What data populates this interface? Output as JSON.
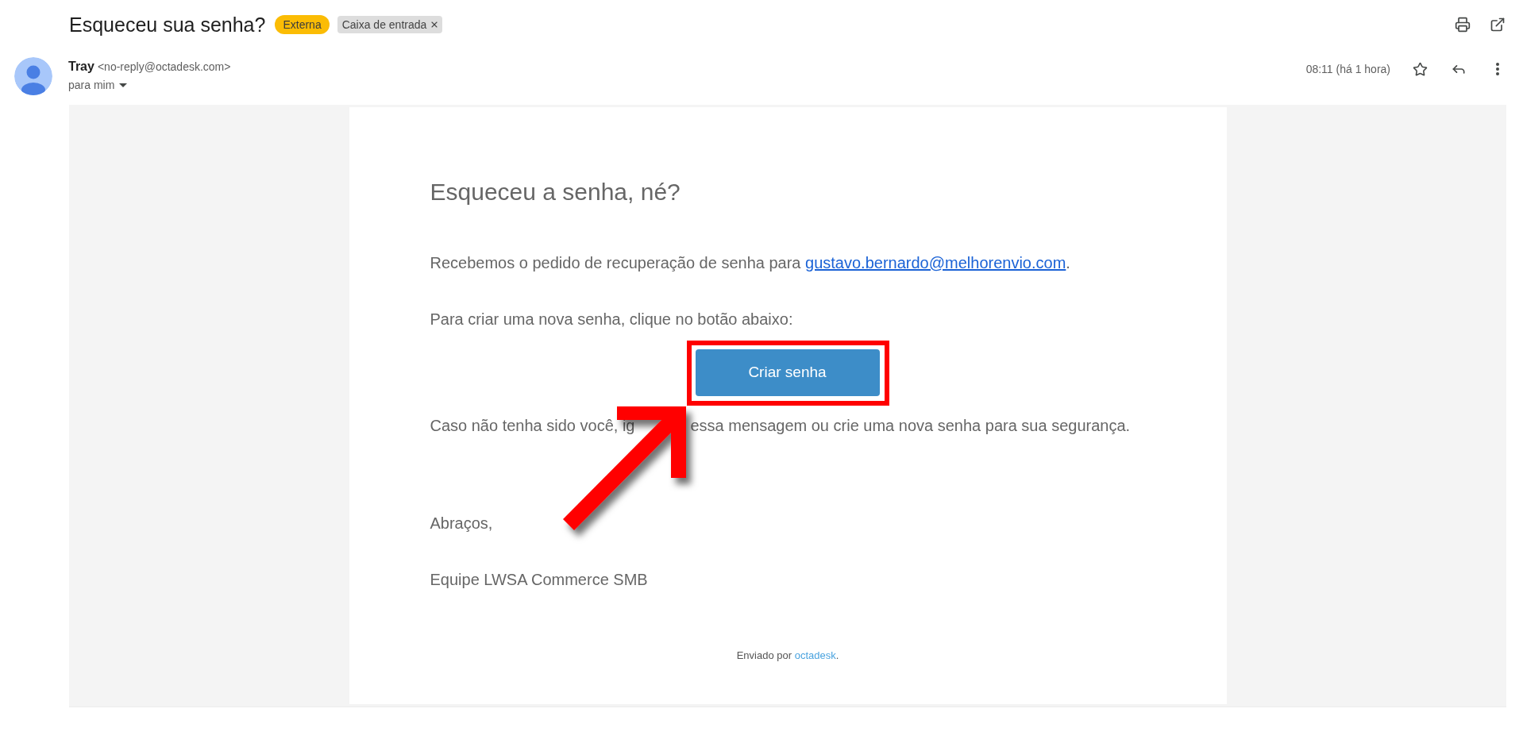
{
  "email": {
    "subject": "Esqueceu sua senha?",
    "labels": [
      {
        "kind": "external",
        "text": "Externa"
      },
      {
        "kind": "folder",
        "text": "Caixa de entrada",
        "removable": true
      }
    ]
  },
  "sender": {
    "name": "Tray",
    "address": "<no-reply@octadesk.com>",
    "recipient": "para mim",
    "time": "08:11 (há 1 hora)",
    "starred": false
  },
  "message": {
    "heading": "Esqueceu a senha, né?",
    "blocks": [
      {
        "kind": "text_link",
        "before": "Recebemos o pedido de recuperação de senha para",
        "link": "gustavo.bernardo@melhorenvio.com",
        "after": "."
      },
      {
        "kind": "text",
        "text": "Para criar uma nova senha, clique no botão abaixo:"
      },
      {
        "kind": "button",
        "label": "Criar senha",
        "highlighted": true
      },
      {
        "kind": "covered_text",
        "parts": [
          "Caso não tenha sido você, ig",
          "essa mensagem ou crie uma nova senha para sua segurança."
        ]
      },
      {
        "kind": "text",
        "text": "Abraços,"
      },
      {
        "kind": "text",
        "text": "Equipe LWSA Commerce SMB"
      }
    ],
    "footer": {
      "before": "Enviado por",
      "link": "octadesk",
      "after": "."
    }
  }
}
